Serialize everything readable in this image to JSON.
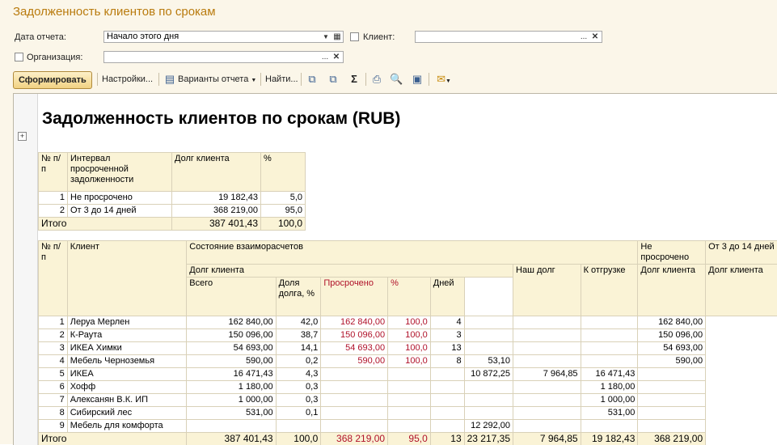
{
  "window_title": "Задолженность клиентов по срокам",
  "form": {
    "date_label": "Дата отчета:",
    "date_value": "Начало этого дня",
    "client_label": "Клиент:",
    "client_value": "",
    "org_label": "Организация:",
    "org_value": "",
    "dots": "...",
    "clear": "✕",
    "dropdown": "▼"
  },
  "toolbar": {
    "generate": "Сформировать",
    "settings": "Настройки...",
    "variants": "Варианты отчета",
    "find": "Найти..."
  },
  "report_title": "Задолженность клиентов по срокам (RUB)",
  "table1": {
    "headers": {
      "num": "№ п/п",
      "interval": "Интервал просроченной задолженности",
      "debt": "Долг клиента",
      "pct": "%"
    },
    "rows": [
      {
        "num": "1",
        "interval": "Не просрочено",
        "debt": "19 182,43",
        "pct": "5,0"
      },
      {
        "num": "2",
        "interval": "От 3 до 14 дней",
        "debt": "368 219,00",
        "pct": "95,0"
      }
    ],
    "total": {
      "label": "Итого",
      "debt": "387 401,43",
      "pct": "100,0"
    }
  },
  "table2": {
    "headers": {
      "num": "№ п/п",
      "client": "Клиент",
      "state": "Состояние взаиморасчетов",
      "not_overdue": "Не просрочено",
      "d3_14": "От 3 до 14 дней",
      "client_debt": "Долг клиента",
      "total": "Всего",
      "share": "Доля долга, %",
      "overdue": "Просрочено",
      "pct": "%",
      "days": "Дней",
      "our_debt": "Наш долг",
      "to_ship": "К отгрузке",
      "nd_debt": "Долг клиента",
      "d_debt": "Долг клиента"
    },
    "rows": [
      {
        "num": "1",
        "client": "Леруа Мерлен",
        "total": "162 840,00",
        "share": "42,0",
        "overdue": "162 840,00",
        "pct": "100,0",
        "days": "4",
        "our": "",
        "ship": "",
        "nd": "",
        "d": "162 840,00"
      },
      {
        "num": "2",
        "client": "К-Раута",
        "total": "150 096,00",
        "share": "38,7",
        "overdue": "150 096,00",
        "pct": "100,0",
        "days": "3",
        "our": "",
        "ship": "",
        "nd": "",
        "d": "150 096,00"
      },
      {
        "num": "3",
        "client": "ИКЕА Химки",
        "total": "54 693,00",
        "share": "14,1",
        "overdue": "54 693,00",
        "pct": "100,0",
        "days": "13",
        "our": "",
        "ship": "",
        "nd": "",
        "d": "54 693,00"
      },
      {
        "num": "4",
        "client": "Мебель Черноземья",
        "total": "590,00",
        "share": "0,2",
        "overdue": "590,00",
        "pct": "100,0",
        "days": "8",
        "our": "53,10",
        "ship": "",
        "nd": "",
        "d": "590,00"
      },
      {
        "num": "5",
        "client": "ИКЕА",
        "total": "16 471,43",
        "share": "4,3",
        "overdue": "",
        "pct": "",
        "days": "",
        "our": "10 872,25",
        "ship": "7 964,85",
        "nd": "16 471,43",
        "d": ""
      },
      {
        "num": "6",
        "client": "Хофф",
        "total": "1 180,00",
        "share": "0,3",
        "overdue": "",
        "pct": "",
        "days": "",
        "our": "",
        "ship": "",
        "nd": "1 180,00",
        "d": ""
      },
      {
        "num": "7",
        "client": "Алексанян В.К. ИП",
        "total": "1 000,00",
        "share": "0,3",
        "overdue": "",
        "pct": "",
        "days": "",
        "our": "",
        "ship": "",
        "nd": "1 000,00",
        "d": ""
      },
      {
        "num": "8",
        "client": "Сибирский лес",
        "total": "531,00",
        "share": "0,1",
        "overdue": "",
        "pct": "",
        "days": "",
        "our": "",
        "ship": "",
        "nd": "531,00",
        "d": ""
      },
      {
        "num": "9",
        "client": "Мебель для комфорта",
        "total": "",
        "share": "",
        "overdue": "",
        "pct": "",
        "days": "",
        "our": "12 292,00",
        "ship": "",
        "nd": "",
        "d": ""
      }
    ],
    "total": {
      "label": "Итого",
      "total": "387 401,43",
      "share": "100,0",
      "overdue": "368 219,00",
      "pct": "95,0",
      "days": "13",
      "our": "23 217,35",
      "ship": "7 964,85",
      "nd": "19 182,43",
      "d": "368 219,00"
    }
  }
}
